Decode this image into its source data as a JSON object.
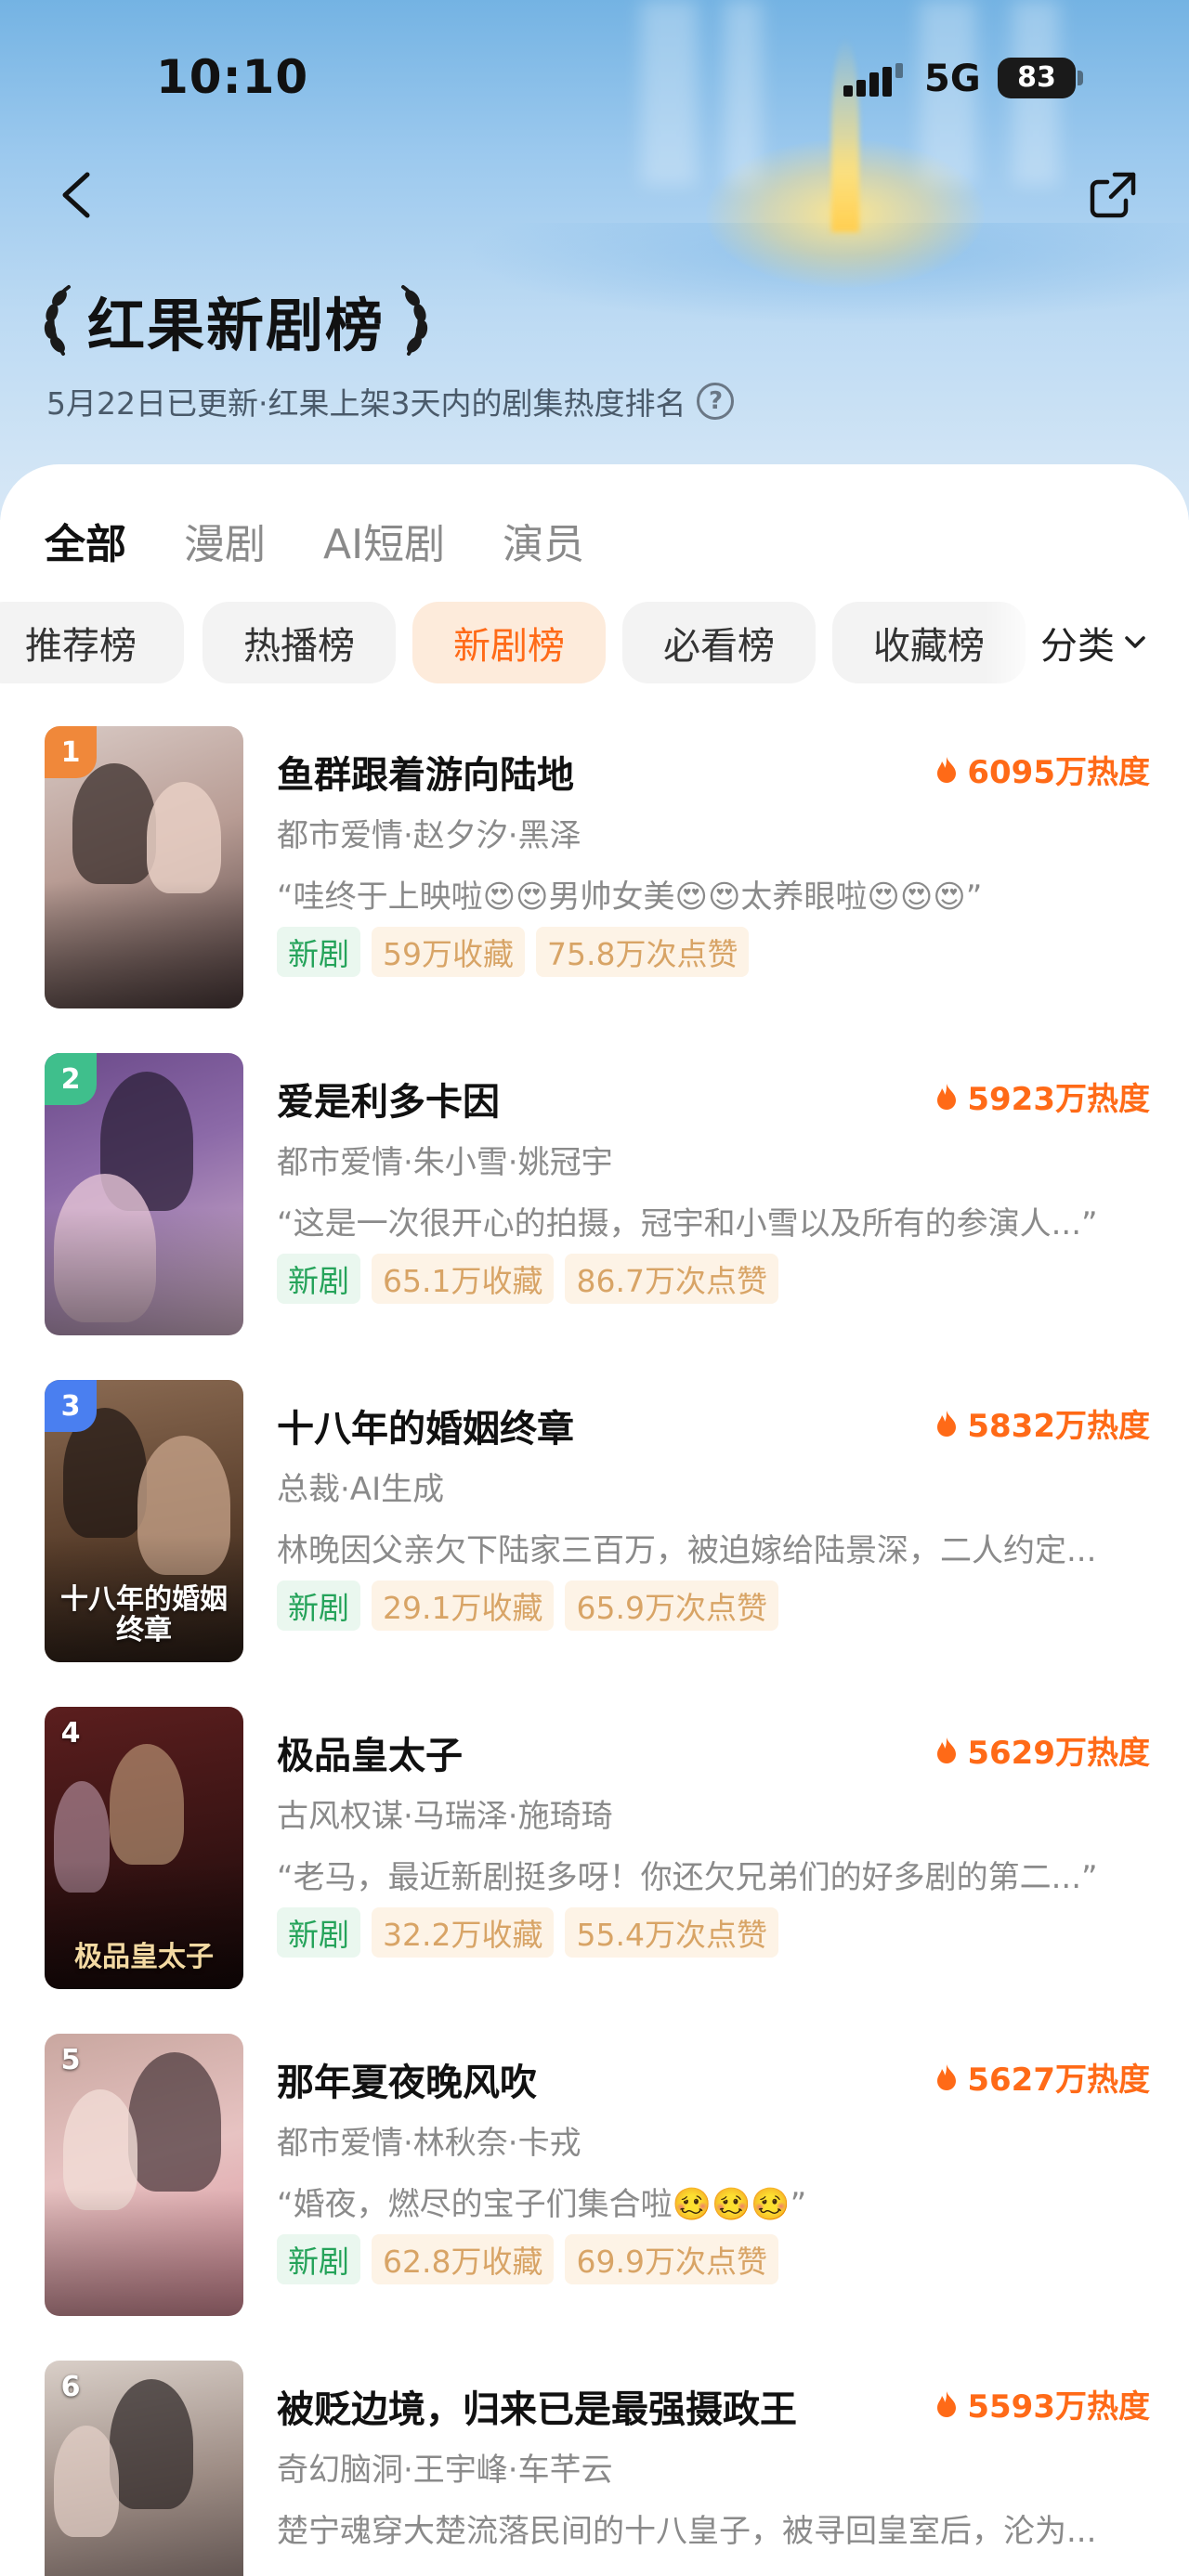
{
  "status_bar": {
    "time": "10:10",
    "network": "5G",
    "battery": "83"
  },
  "header": {
    "title": "红果新剧榜",
    "subtitle": "5月22日已更新·红果上架3天内的剧集热度排名"
  },
  "tabs": [
    {
      "label": "全部",
      "active": true
    },
    {
      "label": "漫剧",
      "active": false
    },
    {
      "label": "AI短剧",
      "active": false
    },
    {
      "label": "演员",
      "active": false
    }
  ],
  "chips": [
    {
      "label": "推荐榜",
      "active": false
    },
    {
      "label": "热播榜",
      "active": false
    },
    {
      "label": "新剧榜",
      "active": true
    },
    {
      "label": "必看榜",
      "active": false
    },
    {
      "label": "收藏榜",
      "active": false
    }
  ],
  "sort_label": "分类",
  "items": [
    {
      "rank": "1",
      "title": "鱼群跟着游向陆地",
      "heat": "6095万热度",
      "meta": "都市爱情·赵夕汐·黑泽",
      "desc": "“哇终于上映啦😍😍男帅女美😍😍太养眼啦😍😍😍”",
      "tag_new": "新剧",
      "favorites": "59万收藏",
      "likes": "75.8万次点赞"
    },
    {
      "rank": "2",
      "title": "爱是利多卡因",
      "heat": "5923万热度",
      "meta": "都市爱情·朱小雪·姚冠宇",
      "desc": "“这是一次很开心的拍摄，冠宇和小雪以及所有的参演人...”",
      "tag_new": "新剧",
      "favorites": "65.1万收藏",
      "likes": "86.7万次点赞"
    },
    {
      "rank": "3",
      "title": "十八年的婚姻终章",
      "heat": "5832万热度",
      "meta": "总裁·AI生成",
      "desc": "林晚因父亲欠下陆家三百万，被迫嫁给陆景深，二人约定...",
      "tag_new": "新剧",
      "favorites": "29.1万收藏",
      "likes": "65.9万次点赞",
      "poster_text": "十八年的婚姻终章"
    },
    {
      "rank": "4",
      "title": "极品皇太子",
      "heat": "5629万热度",
      "meta": "古风权谋·马瑞泽·施琦琦",
      "desc": "“老马，最近新剧挺多呀！你还欠兄弟们的好多剧的第二...”",
      "tag_new": "新剧",
      "favorites": "32.2万收藏",
      "likes": "55.4万次点赞",
      "poster_text": "极品皇太子"
    },
    {
      "rank": "5",
      "title": "那年夏夜晚风吹",
      "heat": "5627万热度",
      "meta": "都市爱情·林秋奈·卡戎",
      "desc": "“婚夜，燃尽的宝子们集合啦🥴🥴🥴”",
      "tag_new": "新剧",
      "favorites": "62.8万收藏",
      "likes": "69.9万次点赞"
    },
    {
      "rank": "6",
      "title": "被贬边境，归来已是最强摄政王",
      "heat": "5593万热度",
      "meta": "奇幻脑洞·王宇峰·车芊云",
      "desc": "楚宁魂穿大楚流落民间的十八皇子，被寻回皇室后，沦为...",
      "tag_new": "",
      "favorites": "",
      "likes": ""
    }
  ],
  "colors": {
    "accent": "#ff6a17",
    "rank1": "#f0883a",
    "rank2": "#3fbf8c",
    "rank3": "#4a7ff0",
    "tag_new_bg": "#eaf7ef",
    "tag_stat_bg": "#fdf3e6"
  }
}
